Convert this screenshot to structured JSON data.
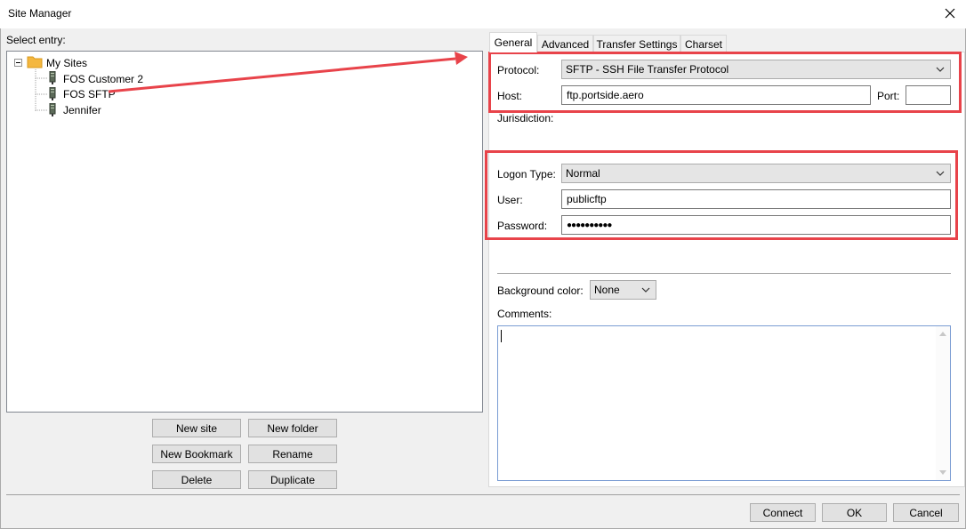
{
  "window": {
    "title": "Site Manager"
  },
  "left": {
    "select_entry_label": "Select entry:",
    "tree": {
      "root_label": "My Sites",
      "items": [
        {
          "label": "FOS Customer 2"
        },
        {
          "label": "FOS SFTP"
        },
        {
          "label": "Jennifer"
        }
      ]
    },
    "buttons": {
      "new_site": "New site",
      "new_folder": "New folder",
      "new_bookmark": "New Bookmark",
      "rename": "Rename",
      "delete": "Delete",
      "duplicate": "Duplicate"
    }
  },
  "tabs": [
    {
      "label": "General",
      "active": true
    },
    {
      "label": "Advanced"
    },
    {
      "label": "Transfer Settings"
    },
    {
      "label": "Charset"
    }
  ],
  "general": {
    "protocol_label": "Protocol:",
    "protocol_value": "SFTP - SSH File Transfer Protocol",
    "host_label": "Host:",
    "host_value": "ftp.portside.aero",
    "port_label": "Port:",
    "port_value": "",
    "jurisdiction_label": "Jurisdiction:",
    "logon_type_label": "Logon Type:",
    "logon_type_value": "Normal",
    "user_label": "User:",
    "user_value": "publicftp",
    "password_label": "Password:",
    "password_value": "●●●●●●●●●●",
    "background_color_label": "Background color:",
    "background_color_value": "None",
    "comments_label": "Comments:"
  },
  "footer": {
    "connect": "Connect",
    "ok": "OK",
    "cancel": "Cancel"
  },
  "colors": {
    "annotation": "#e8434a",
    "folder": "#f4b73f"
  },
  "icons": [
    "close-icon",
    "folder-icon",
    "server-icon",
    "chevron-down-icon",
    "arrow-annotation"
  ]
}
